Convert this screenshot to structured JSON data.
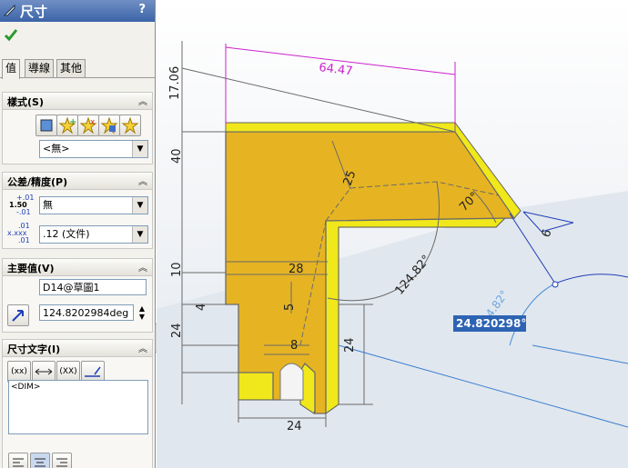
{
  "panel": {
    "title": "尺寸",
    "help": "?",
    "tabs": [
      "值",
      "導線",
      "其他"
    ],
    "style_group": {
      "title": "樣式(S)",
      "select_value": "<無>"
    },
    "tolerance_group": {
      "title": "公差/精度(P)",
      "tolerance_value": "無",
      "precision_value": ".12 (文件)",
      "tol_icon_top": "+.01",
      "tol_icon_mid": "1.50",
      "tol_icon_bot": "-.01",
      "prec_icon_top": ".01",
      "prec_icon_mid": "x.xxx",
      "prec_icon_bot": ".01"
    },
    "primary_group": {
      "title": "主要值(V)",
      "name_value": "D14@草圖1",
      "value": "124.8202984deg"
    },
    "text_group": {
      "title": "尺寸文字(I)",
      "btn1": "(xx)",
      "btn3": "(XX)",
      "text_value": "<DIM>"
    }
  },
  "viewport": {
    "dims": {
      "d6447": "64.47",
      "d1706": "17.06",
      "d40": "40",
      "d10": "10",
      "d24left": "24",
      "d4": "4",
      "d25": "25",
      "d28": "28",
      "d5": "5",
      "d8": "8",
      "d24right": "24",
      "d24bottom": "24",
      "d70": "70°",
      "d6": "6",
      "d12482": "124.82°",
      "ghost": "4.82°"
    },
    "edit_value": "24.820298°"
  },
  "colors": {
    "part": "#e6b422",
    "side": "#f0e81a",
    "dim_blue": "#1f3fb8",
    "dim_magenta": "#cc22cc",
    "selected": "#2d63b3"
  }
}
